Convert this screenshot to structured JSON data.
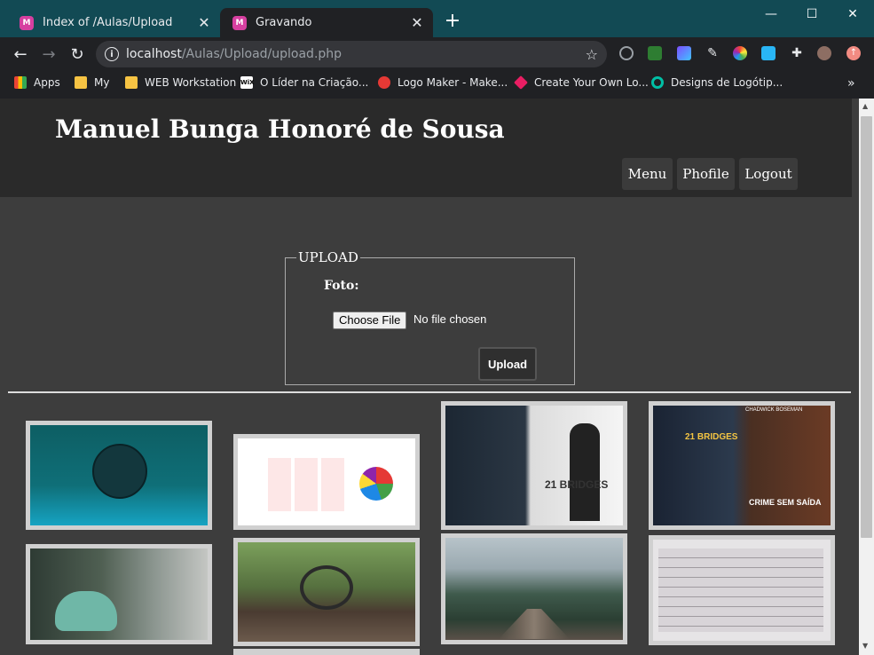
{
  "browser": {
    "tabs": [
      {
        "title": "Index of /Aulas/Upload",
        "favicon": "page-icon"
      },
      {
        "title": "Gravando",
        "favicon": "page-icon"
      }
    ],
    "active_tab": 1,
    "address": {
      "host": "localhost",
      "path": "/Aulas/Upload/upload.php"
    },
    "bookmarks": [
      {
        "label": "Apps",
        "icon": "apps-grid-icon",
        "color": "#4285f4"
      },
      {
        "label": "My",
        "icon": "folder-icon",
        "color": "#f6c343"
      },
      {
        "label": "WEB Workstation",
        "icon": "folder-icon",
        "color": "#f6c343"
      },
      {
        "label": "O Líder na Criação...",
        "icon": "wix-icon",
        "color": "#ffffff"
      },
      {
        "label": "Logo Maker - Make...",
        "icon": "logo-maker-icon",
        "color": "#e53935"
      },
      {
        "label": "Create Your Own Lo...",
        "icon": "diamond-icon",
        "color": "#e91e63"
      },
      {
        "label": "Designs de Logótip...",
        "icon": "designs-icon",
        "color": "#00bfa5"
      }
    ]
  },
  "site": {
    "title": "Manuel Bunga Honoré de Sousa",
    "nav": [
      "Menu",
      "Phofile",
      "Logout"
    ]
  },
  "form": {
    "legend": "UPLOAD",
    "foto_label": "Foto:",
    "choose_file": "Choose File",
    "no_file": "No file chosen",
    "upload": "Upload"
  },
  "gallery": [
    {
      "name": "gallery-image-logo",
      "alt": "Logo"
    },
    {
      "name": "gallery-image-price-table",
      "alt": "Price table"
    },
    {
      "name": "gallery-image-21-bridges-dvd",
      "alt": "21 Bridges DVD cover"
    },
    {
      "name": "gallery-image-21-bridges-poster",
      "alt": "21 Bridges poster"
    },
    {
      "name": "gallery-image-scooter",
      "alt": "Scooter"
    },
    {
      "name": "gallery-image-truck-interior",
      "alt": "Truck interior"
    },
    {
      "name": "gallery-image-railway",
      "alt": "Railway"
    },
    {
      "name": "gallery-image-document",
      "alt": "Document"
    }
  ],
  "poster_texts": {
    "bridges": "21 BRIDGES",
    "crime": "CRIME SEM SAÍDA",
    "actor": "CHADWICK BOSEMAN"
  }
}
